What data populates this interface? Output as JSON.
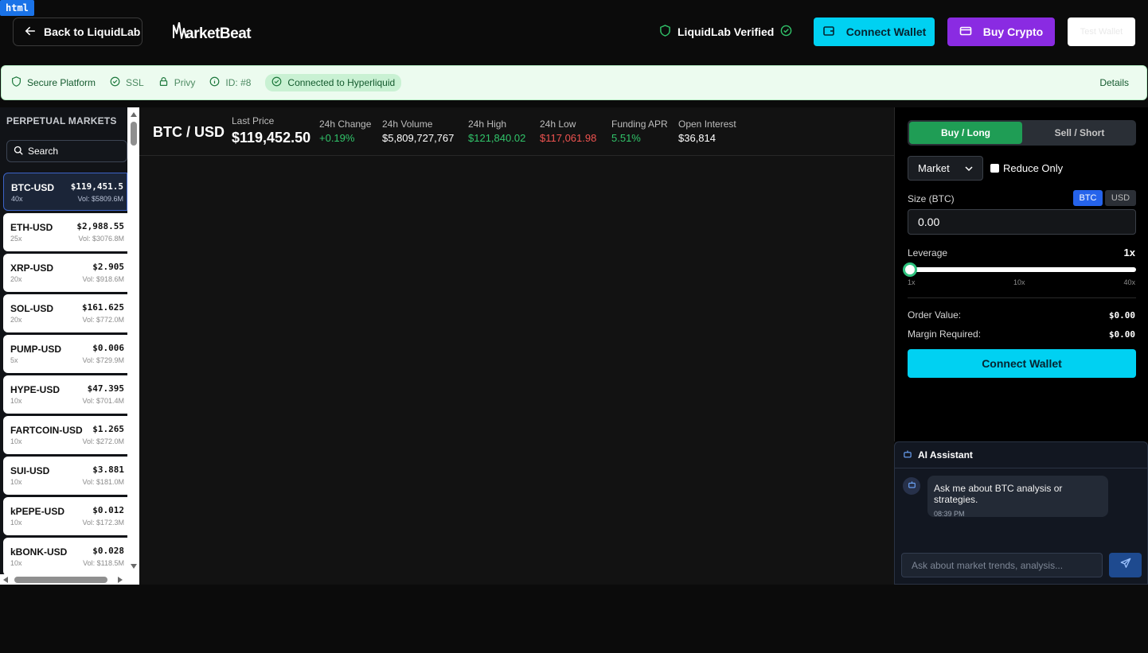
{
  "debug_tag": "html",
  "header": {
    "back_label": "Back to LiquidLab",
    "logo_text": "arketBeat",
    "verified_label": "LiquidLab Verified",
    "connect_wallet": "Connect Wallet",
    "buy_crypto": "Buy Crypto",
    "test_wallet": "Test Wallet"
  },
  "security": {
    "secure": "Secure Platform",
    "ssl": "SSL",
    "privy": "Privy",
    "id": "ID: #8",
    "connected": "Connected to Hyperliquid",
    "details": "Details"
  },
  "sidebar": {
    "title": "PERPETUAL MARKETS",
    "search_label": "Search",
    "markets": [
      {
        "symbol": "BTC-USD",
        "leverage": "40x",
        "price": "$119,451.5",
        "volume": "Vol: $5809.6M"
      },
      {
        "symbol": "ETH-USD",
        "leverage": "25x",
        "price": "$2,988.55",
        "volume": "Vol: $3076.8M"
      },
      {
        "symbol": "XRP-USD",
        "leverage": "20x",
        "price": "$2.905",
        "volume": "Vol: $918.6M"
      },
      {
        "symbol": "SOL-USD",
        "leverage": "20x",
        "price": "$161.625",
        "volume": "Vol: $772.0M"
      },
      {
        "symbol": "PUMP-USD",
        "leverage": "5x",
        "price": "$0.006",
        "volume": "Vol: $729.9M"
      },
      {
        "symbol": "HYPE-USD",
        "leverage": "10x",
        "price": "$47.395",
        "volume": "Vol: $701.4M"
      },
      {
        "symbol": "FARTCOIN-USD",
        "leverage": "10x",
        "price": "$1.265",
        "volume": "Vol: $272.0M"
      },
      {
        "symbol": "SUI-USD",
        "leverage": "10x",
        "price": "$3.881",
        "volume": "Vol: $181.0M"
      },
      {
        "symbol": "kPEPE-USD",
        "leverage": "10x",
        "price": "$0.012",
        "volume": "Vol: $172.3M"
      },
      {
        "symbol": "kBONK-USD",
        "leverage": "10x",
        "price": "$0.028",
        "volume": "Vol: $118.5M"
      }
    ]
  },
  "ticker": {
    "pair": "BTC / USD",
    "last_price_label": "Last Price",
    "last_price": "$119,452.50",
    "change_label": "24h Change",
    "change": "+0.19%",
    "volume_label": "24h Volume",
    "volume": "$5,809,727,767",
    "high_label": "24h High",
    "high": "$121,840.02",
    "low_label": "24h Low",
    "low": "$117,061.98",
    "funding_label": "Funding APR",
    "funding": "5.51%",
    "oi_label": "Open Interest",
    "oi": "$36,814"
  },
  "order": {
    "buy_tab": "Buy / Long",
    "sell_tab": "Sell / Short",
    "order_type": "Market",
    "reduce_only": "Reduce Only",
    "size_label": "Size (BTC)",
    "unit_btc": "BTC",
    "unit_usd": "USD",
    "size_value": "0.00",
    "leverage_label": "Leverage",
    "leverage_value": "1x",
    "leverage_fraction": 0,
    "tick_min": "1x",
    "tick_mid": "10x",
    "tick_max": "40x",
    "order_value_label": "Order Value:",
    "order_value": "$0.00",
    "margin_label": "Margin Required:",
    "margin_value": "$0.00",
    "connect_wallet": "Connect Wallet"
  },
  "ai": {
    "title": "AI Assistant",
    "message": "Ask me about BTC analysis or strategies.",
    "time": "08:39 PM",
    "placeholder": "Ask about market trends, analysis..."
  },
  "colors": {
    "accent_cyan": "#00d1f2",
    "accent_purple": "#8a2be2",
    "positive": "#31c46a",
    "negative": "#ef5350"
  }
}
